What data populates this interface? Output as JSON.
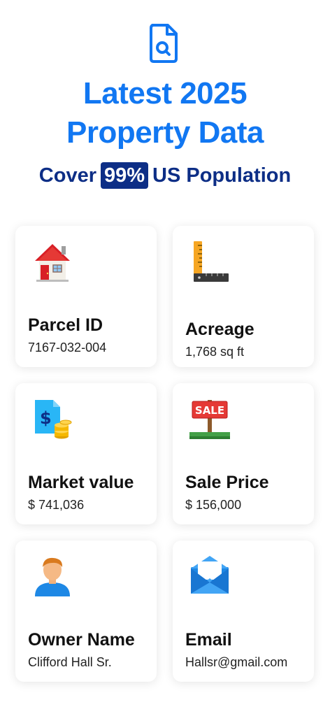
{
  "header": {
    "icon": "document-search-icon",
    "title_line1": "Latest 2025",
    "title_line2": "Property Data",
    "subtitle_prefix": "Cover",
    "subtitle_highlight": "99%",
    "subtitle_suffix": "US Population",
    "accent_color": "#1177f2",
    "dark_color": "#0d2e86"
  },
  "cards": [
    {
      "label": "Parcel ID",
      "value": "7167-032-004",
      "icon": "house-icon"
    },
    {
      "label": "Acreage",
      "value": "1,768 sq ft",
      "icon": "ruler-icon"
    },
    {
      "label": "Market value",
      "value": "$ 741,036",
      "icon": "money-document-icon"
    },
    {
      "label": "Sale Price",
      "value": "$ 156,000",
      "icon": "sale-sign-icon"
    },
    {
      "label": "Owner Name",
      "value": "Clifford Hall Sr.",
      "icon": "person-icon"
    },
    {
      "label": "Email",
      "value": "Hallsr@gmail.com",
      "icon": "envelope-icon"
    }
  ]
}
